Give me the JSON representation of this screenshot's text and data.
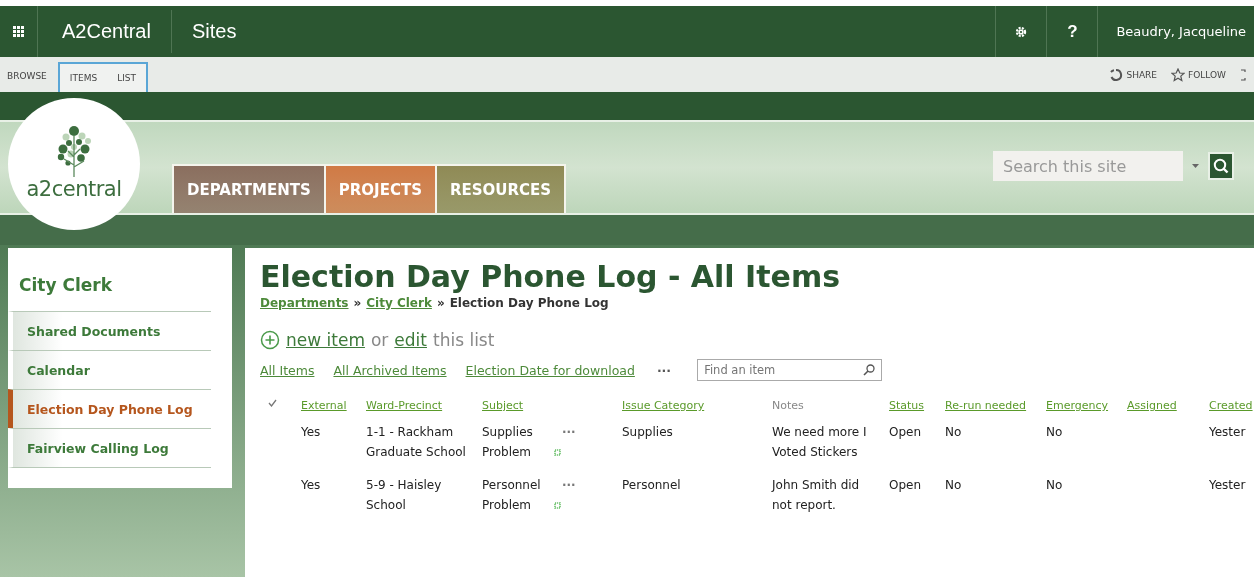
{
  "suite_bar": {
    "brand": "A2Central",
    "section": "Sites",
    "help": "?",
    "user": "Beaudry, Jacqueline"
  },
  "ribbon": {
    "tabs": [
      {
        "label": "BROWSE",
        "contextual": false
      },
      {
        "label": "ITEMS",
        "contextual": true
      },
      {
        "label": "LIST",
        "contextual": true
      }
    ],
    "actions": [
      {
        "kind": "share",
        "label": "SHARE"
      },
      {
        "kind": "follow",
        "label": "FOLLOW"
      },
      {
        "kind": "focus"
      }
    ]
  },
  "header": {
    "logo_text": "a2central",
    "nav": [
      {
        "label": "DEPARTMENTS",
        "color": "#8a6e5e"
      },
      {
        "label": "PROJECTS",
        "color": "#d07a45"
      },
      {
        "label": "RESOURCES",
        "color": "#8f8a55"
      }
    ],
    "search": {
      "placeholder": "Search this site"
    }
  },
  "sidebar": {
    "title": "City Clerk",
    "items": [
      {
        "label": "Shared Documents",
        "selected": false
      },
      {
        "label": "Calendar",
        "selected": false
      },
      {
        "label": "Election Day Phone Log",
        "selected": true
      },
      {
        "label": "Fairview Calling Log",
        "selected": false
      }
    ]
  },
  "page": {
    "title": "Election Day Phone Log - All Items",
    "breadcrumb": [
      {
        "label": "Departments",
        "link": true
      },
      {
        "label": "City Clerk",
        "link": true
      },
      {
        "label": "Election Day Phone Log",
        "link": false
      }
    ],
    "breadcrumb_separator": "»",
    "new_item": {
      "new_label": "new item",
      "or": "or",
      "edit_label": "edit",
      "rest": "this list"
    },
    "views": [
      {
        "label": "All Items"
      },
      {
        "label": "All Archived Items"
      },
      {
        "label": "Election Date for download"
      }
    ],
    "views_more": "···",
    "find": {
      "placeholder": "Find an item"
    }
  },
  "table": {
    "columns": [
      {
        "label": "External",
        "sortable": true
      },
      {
        "label": "Ward-Precinct",
        "sortable": true
      },
      {
        "label": "Subject",
        "sortable": true
      },
      {
        "label": "Issue Category",
        "sortable": true
      },
      {
        "label": "Notes",
        "sortable": false
      },
      {
        "label": "Status",
        "sortable": true
      },
      {
        "label": "Re-run needed",
        "sortable": true
      },
      {
        "label": "Emergency",
        "sortable": true
      },
      {
        "label": "Assigned",
        "sortable": true
      },
      {
        "label": "Created",
        "sortable": true
      }
    ],
    "rows": [
      {
        "cells": [
          "Yes",
          "1-1 - Rackham Graduate School",
          "Supplies Problem",
          "Supplies",
          "We need more I Voted Stickers",
          "Open",
          "No",
          "No",
          "",
          "Yester"
        ],
        "new": true,
        "menu": "···"
      },
      {
        "cells": [
          "Yes",
          "5-9 - Haisley School",
          "Personnel Problem",
          "Personnel",
          "John Smith did not report.",
          "Open",
          "No",
          "No",
          "",
          "Yester"
        ],
        "new": true,
        "menu": "···"
      }
    ]
  }
}
